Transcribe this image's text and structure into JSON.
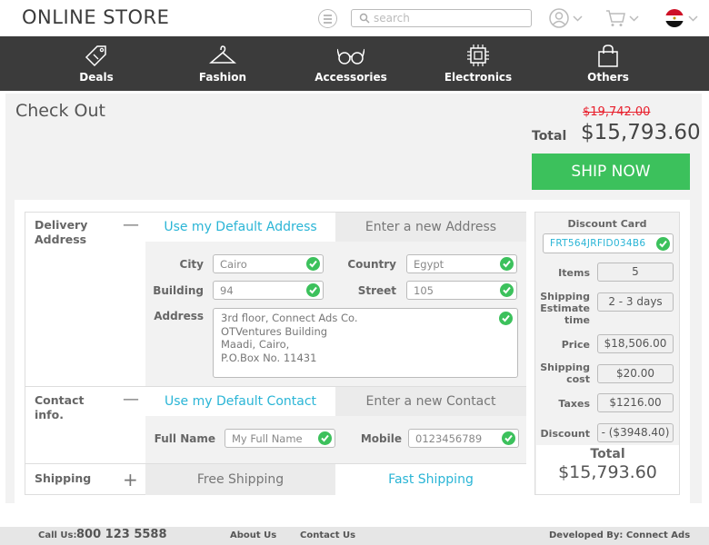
{
  "header": {
    "logo": "ONLINE STORE",
    "search_placeholder": "search",
    "icons": [
      "menu-icon",
      "search-icon",
      "user-icon",
      "cart-icon",
      "egypt-flag-icon"
    ]
  },
  "nav": {
    "items": [
      {
        "label": "Deals",
        "icon": "price-tag-icon"
      },
      {
        "label": "Fashion",
        "icon": "hanger-icon"
      },
      {
        "label": "Accessories",
        "icon": "glasses-icon"
      },
      {
        "label": "Electronics",
        "icon": "chip-icon"
      },
      {
        "label": "Others",
        "icon": "shopping-bag-icon"
      }
    ]
  },
  "checkout": {
    "title": "Check Out",
    "old_total": "$19,742.00",
    "total_label": "Total",
    "total_value": "$15,793.60",
    "ship_now": "SHIP NOW"
  },
  "delivery": {
    "label": "Delivery Address",
    "toggle": "—",
    "tab_default": "Use my Default Address",
    "tab_new": "Enter a new Address",
    "city_label": "City",
    "city_value": "Cairo",
    "country_label": "Country",
    "country_value": "Egypt",
    "building_label": "Building",
    "building_value": "94",
    "street_label": "Street",
    "street_value": "105",
    "address_label": "Address",
    "address_lines": [
      "3rd floor, Connect Ads Co.",
      "OTVentures Building",
      "Maadi, Cairo,",
      "P.O.Box No. 11431"
    ]
  },
  "contact": {
    "label": "Contact info.",
    "toggle": "—",
    "tab_default": "Use my Default Contact",
    "tab_new": "Enter a new Contact",
    "fullname_label": "Full Name",
    "fullname_placeholder": "My Full Name",
    "mobile_label": "Mobile",
    "mobile_placeholder": "0123456789"
  },
  "shipping": {
    "label": "Shipping",
    "toggle": "+",
    "free": "Free Shipping",
    "fast": "Fast Shipping"
  },
  "summary": {
    "discount_label": "Discount Card",
    "discount_code": "FRT564JRFID034B6",
    "items_label": "Items",
    "items_value": "5",
    "estimate_label": "Shipping Estimate time",
    "estimate_value": "2 - 3 days",
    "price_label": "Price",
    "price_value": "$18,506.00",
    "shipcost_label": "Shipping cost",
    "shipcost_value": "$20.00",
    "taxes_label": "Taxes",
    "taxes_value": "$1216.00",
    "discount_row_label": "Discount",
    "discount_row_value": "- ($3948.40)",
    "total_label": "Total",
    "total_value": "$15,793.60"
  },
  "footer": {
    "call_label": "Call Us:",
    "phone": "800 123 5588",
    "about": "About Us",
    "contact": "Contact Us",
    "developed": "Developed By: Connect Ads"
  },
  "colors": {
    "accent": "#2ab5d6",
    "green": "#3cc15c",
    "nav_bg": "#3b3b3b",
    "strike_red": "#e8212e"
  }
}
